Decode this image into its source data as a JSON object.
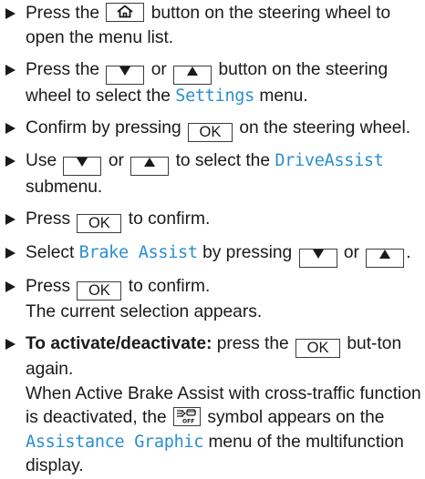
{
  "steps": [
    {
      "before": "Press the",
      "key_label": "",
      "after": "button on the steering wheel to open the menu list."
    },
    {
      "before": "Press the",
      "or": "or",
      "after": "button on the steering wheel to select the",
      "menu": "Settings",
      "end": "menu."
    },
    {
      "before": "Confirm by pressing",
      "key_label": "OK",
      "after": "on the steering wheel."
    },
    {
      "before": "Use",
      "or": "or",
      "after": "to select the",
      "menu": "DriveAssist",
      "end": "submenu."
    },
    {
      "before": "Press",
      "key_label": "OK",
      "after": "to confirm."
    },
    {
      "before": "Select",
      "menu": "Brake Assist",
      "after": "by pressing",
      "or": "or",
      "end": "."
    },
    {
      "before": "Press",
      "key_label": "OK",
      "after": "to confirm.",
      "line2": "The current selection appears."
    },
    {
      "bold": "To activate/deactivate:",
      "before": "press the",
      "key_label": "OK",
      "after": "but-ton again.",
      "line2a": "When Active Brake Assist with cross-traffic function is deactivated, the",
      "line2b": "symbol appears on the",
      "menu": "Assistance Graphic",
      "line2c": "menu of the multifunction display."
    }
  ],
  "icons": {
    "home": "home-icon",
    "down": "down-arrow-icon",
    "up": "up-arrow-icon",
    "cross_traffic_off": "cross-traffic-off-icon"
  },
  "colors": {
    "menu_text": "#2a8fd0",
    "text": "#1a1a1a"
  }
}
